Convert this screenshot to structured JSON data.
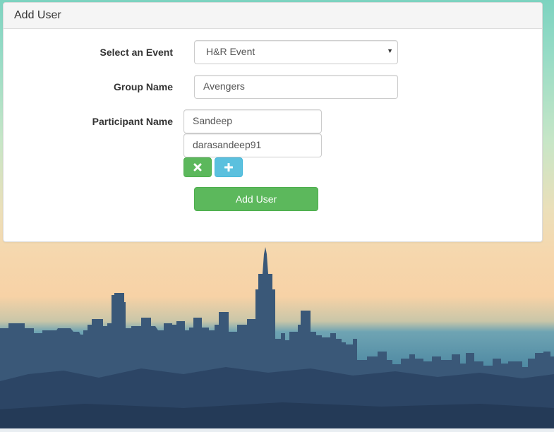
{
  "panel": {
    "title": "Add User"
  },
  "form": {
    "event": {
      "label": "Select an Event",
      "value": "H&R Event"
    },
    "group": {
      "label": "Group Name",
      "value": "Avengers"
    },
    "participant": {
      "label": "Participant Name",
      "name_value": "Sandeep",
      "username_value": "darasandeep91"
    },
    "remove_icon": "close-icon",
    "add_icon": "plus-icon",
    "submit_label": "Add User"
  },
  "colors": {
    "success": "#5cb85c",
    "info": "#5bc0de",
    "panel_heading": "#f5f5f5"
  }
}
